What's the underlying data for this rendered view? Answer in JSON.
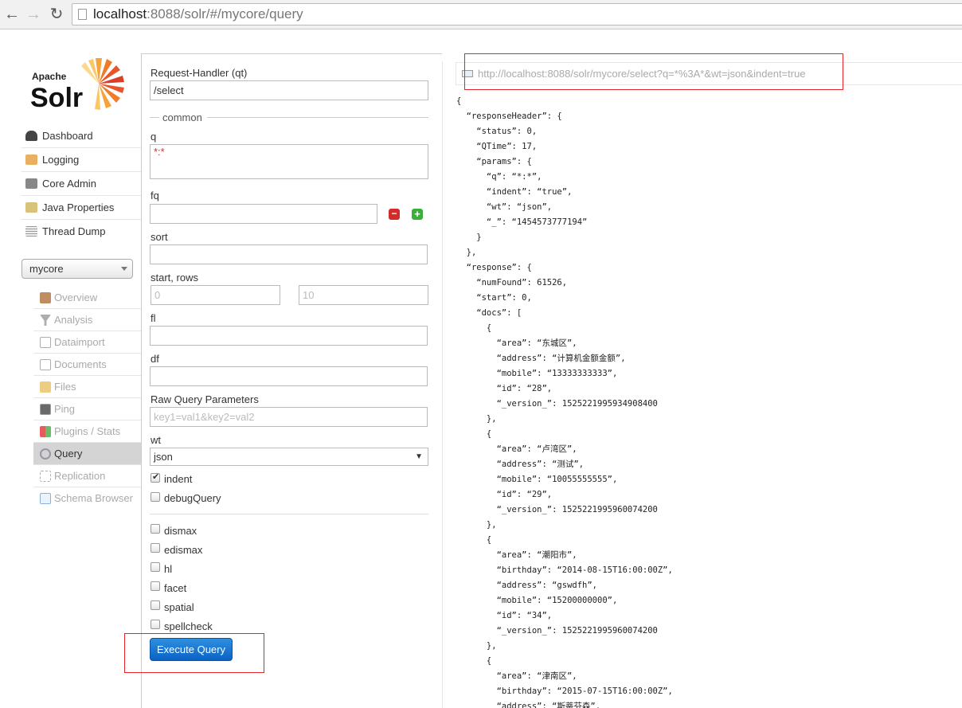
{
  "browser": {
    "url_host": "localhost",
    "url_rest": ":8088/solr/#/mycore/query"
  },
  "logo": {
    "line1": "Apache",
    "line2": "Solr"
  },
  "sidebar": {
    "items": [
      {
        "label": "Dashboard",
        "icon": "dashboard-icon",
        "color": "#444"
      },
      {
        "label": "Logging",
        "icon": "logging-icon",
        "color": "#e8b060"
      },
      {
        "label": "Core Admin",
        "icon": "core-admin-icon",
        "color": "#888"
      },
      {
        "label": "Java Properties",
        "icon": "java-icon",
        "color": "#d9c27a"
      },
      {
        "label": "Thread Dump",
        "icon": "thread-dump-icon",
        "color": "#bbb"
      }
    ]
  },
  "core_selector": {
    "value": "mycore"
  },
  "core_nav": {
    "items": [
      {
        "label": "Overview",
        "icon": "house-icon",
        "color": "#b0703a"
      },
      {
        "label": "Analysis",
        "icon": "funnel-icon",
        "color": "#888"
      },
      {
        "label": "Dataimport",
        "icon": "dataimport-icon",
        "color": "#ccc"
      },
      {
        "label": "Documents",
        "icon": "documents-icon",
        "color": "#bbb"
      },
      {
        "label": "Files",
        "icon": "folder-icon",
        "color": "#e8c060"
      },
      {
        "label": "Ping",
        "icon": "ping-icon",
        "color": "#555"
      },
      {
        "label": "Plugins / Stats",
        "icon": "plugins-icon",
        "color": "#d33"
      },
      {
        "label": "Query",
        "icon": "magnifier-icon",
        "color": "#9ab"
      },
      {
        "label": "Replication",
        "icon": "replication-icon",
        "color": "#aaa"
      },
      {
        "label": "Schema Browser",
        "icon": "schema-icon",
        "color": "#6a9fd8"
      }
    ],
    "active": "Query"
  },
  "form": {
    "qt_label": "Request-Handler (qt)",
    "qt_value": "/select",
    "common_legend": "common",
    "q_label": "q",
    "q_value": "*:*",
    "fq_label": "fq",
    "fq_value": "",
    "sort_label": "sort",
    "sort_value": "",
    "start_rows_label": "start, rows",
    "start_placeholder": "0",
    "rows_placeholder": "10",
    "fl_label": "fl",
    "fl_value": "",
    "df_label": "df",
    "df_value": "",
    "raw_label": "Raw Query Parameters",
    "raw_placeholder": "key1=val1&key2=val2",
    "wt_label": "wt",
    "wt_value": "json",
    "checkboxes": [
      {
        "label": "indent",
        "checked": true
      },
      {
        "label": "debugQuery",
        "checked": false
      },
      {
        "label": "dismax",
        "checked": false
      },
      {
        "label": "edismax",
        "checked": false
      },
      {
        "label": "hl",
        "checked": false
      },
      {
        "label": "facet",
        "checked": false
      },
      {
        "label": "spatial",
        "checked": false
      },
      {
        "label": "spellcheck",
        "checked": false
      }
    ],
    "execute_label": "Execute Query"
  },
  "result": {
    "request_url": "http://localhost:8088/solr/mycore/select?q=*%3A*&wt=json&indent=true",
    "json_lines": [
      "{",
      "  “responseHeader”: {",
      "    “status”: 0,",
      "    “QTime”: 17,",
      "    “params”: {",
      "      “q”: “*:*”,",
      "      “indent”: “true”,",
      "      “wt”: “json”,",
      "      “_”: “1454573777194”",
      "    }",
      "  },",
      "  “response”: {",
      "    “numFound”: 61526,",
      "    “start”: 0,",
      "    “docs”: [",
      "      {",
      "        “area”: “东城区”,",
      "        “address”: “计算机金额金额”,",
      "        “mobile”: “13333333333”,",
      "        “id”: “28”,",
      "        “_version_”: 1525221995934908400",
      "      },",
      "      {",
      "        “area”: “卢湾区”,",
      "        “address”: “测试”,",
      "        “mobile”: “10055555555”,",
      "        “id”: “29”,",
      "        “_version_”: 1525221995960074200",
      "      },",
      "      {",
      "        “area”: “潮阳市”,",
      "        “birthday”: “2014-08-15T16:00:00Z”,",
      "        “address”: “gswdfh”,",
      "        “mobile”: “15200000000”,",
      "        “id”: “34”,",
      "        “_version_”: 1525221995960074200",
      "      },",
      "      {",
      "        “area”: “津南区”,",
      "        “birthday”: “2015-07-15T16:00:00Z”,",
      "        “address”: “斯蒂芬森”,"
    ]
  },
  "colors": {
    "highlight_box": "#e0262c",
    "button": "#0a62c4"
  }
}
